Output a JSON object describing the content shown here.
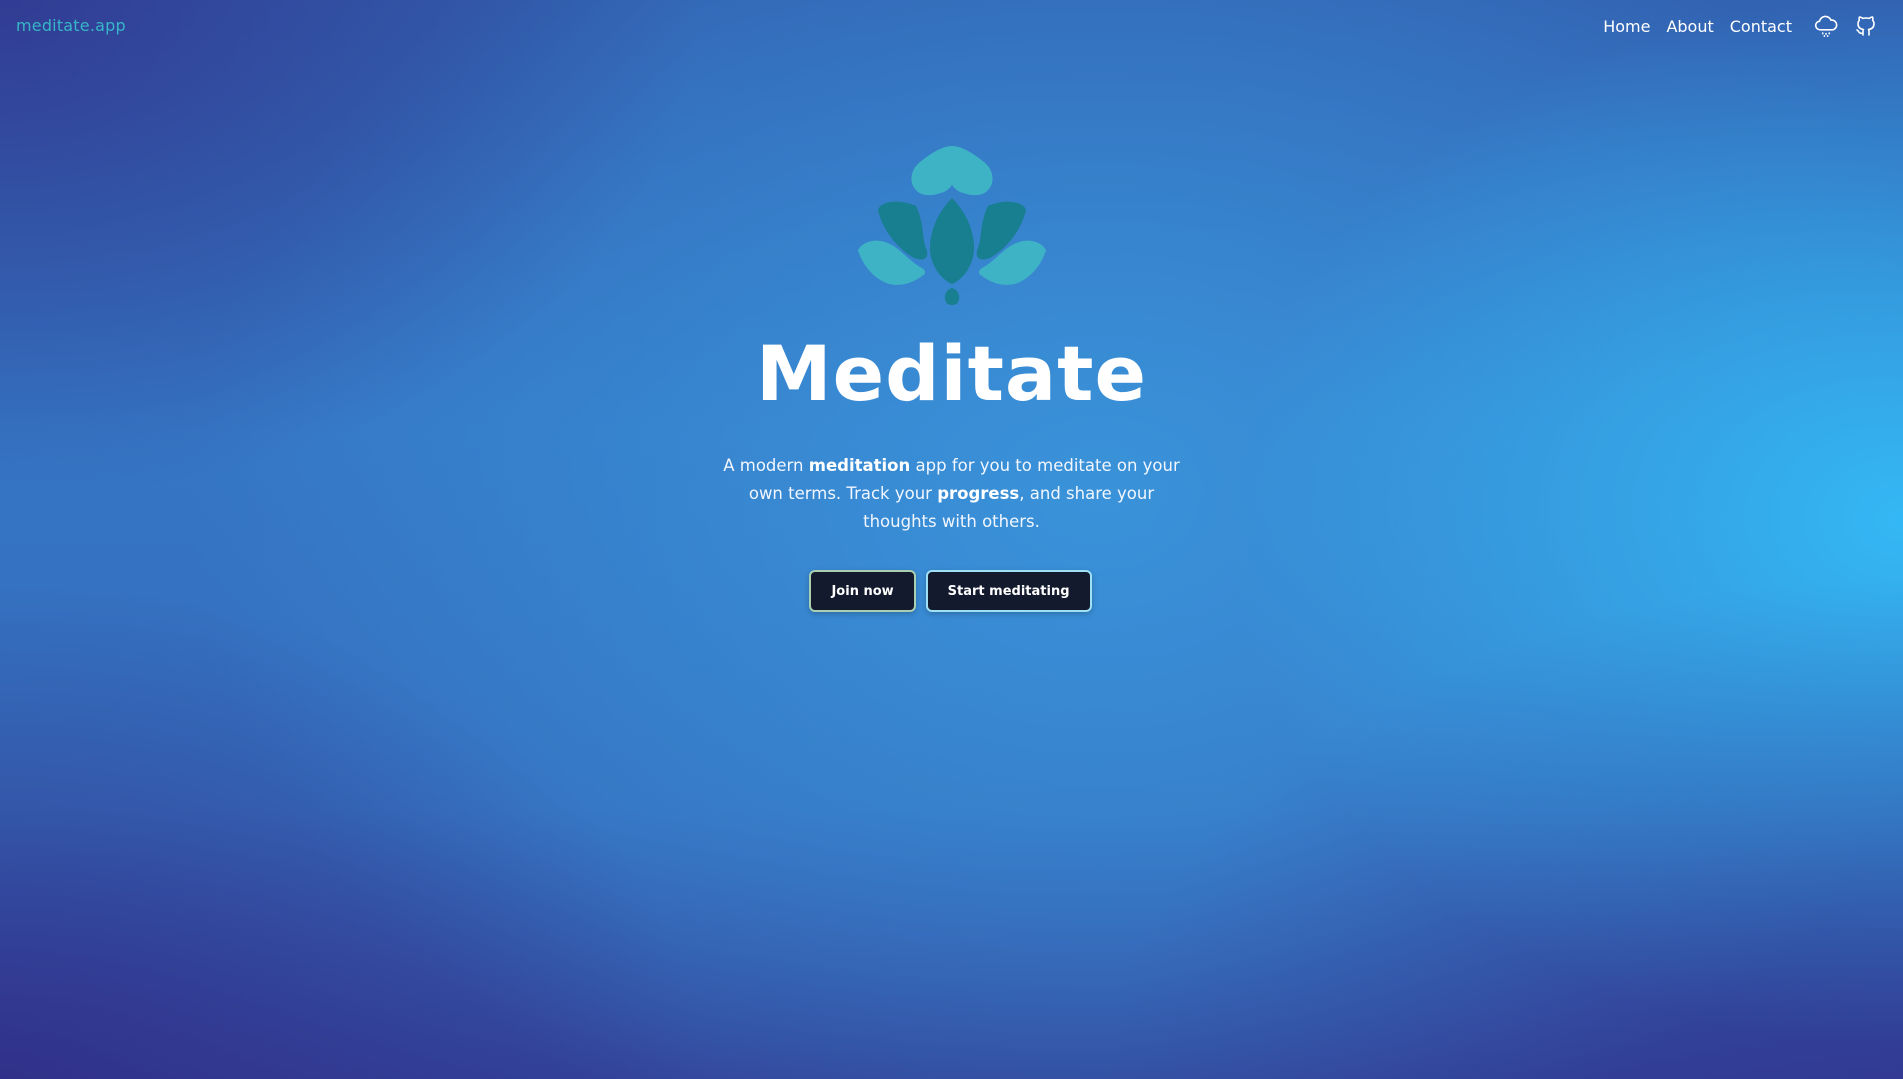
{
  "header": {
    "brand": "meditate.app",
    "nav": [
      {
        "label": "Home"
      },
      {
        "label": "About"
      },
      {
        "label": "Contact"
      }
    ],
    "icons": [
      "cloud-rain-icon",
      "github-icon"
    ]
  },
  "hero": {
    "logo_icon": "lotus-icon",
    "title": "Meditate",
    "description": {
      "part1": "A modern ",
      "bold1": "meditation",
      "part2": " app for you to meditate on your own terms. Track your ",
      "bold2": "progress",
      "part3": ", and share your thoughts with others."
    },
    "buttons": {
      "join": "Join now",
      "start": "Start meditating"
    }
  },
  "colors": {
    "brand": "#36b6c8",
    "button_bg": "#131a2e",
    "lotus_light": "#3fb3c6",
    "lotus_dark": "#177f8f"
  }
}
